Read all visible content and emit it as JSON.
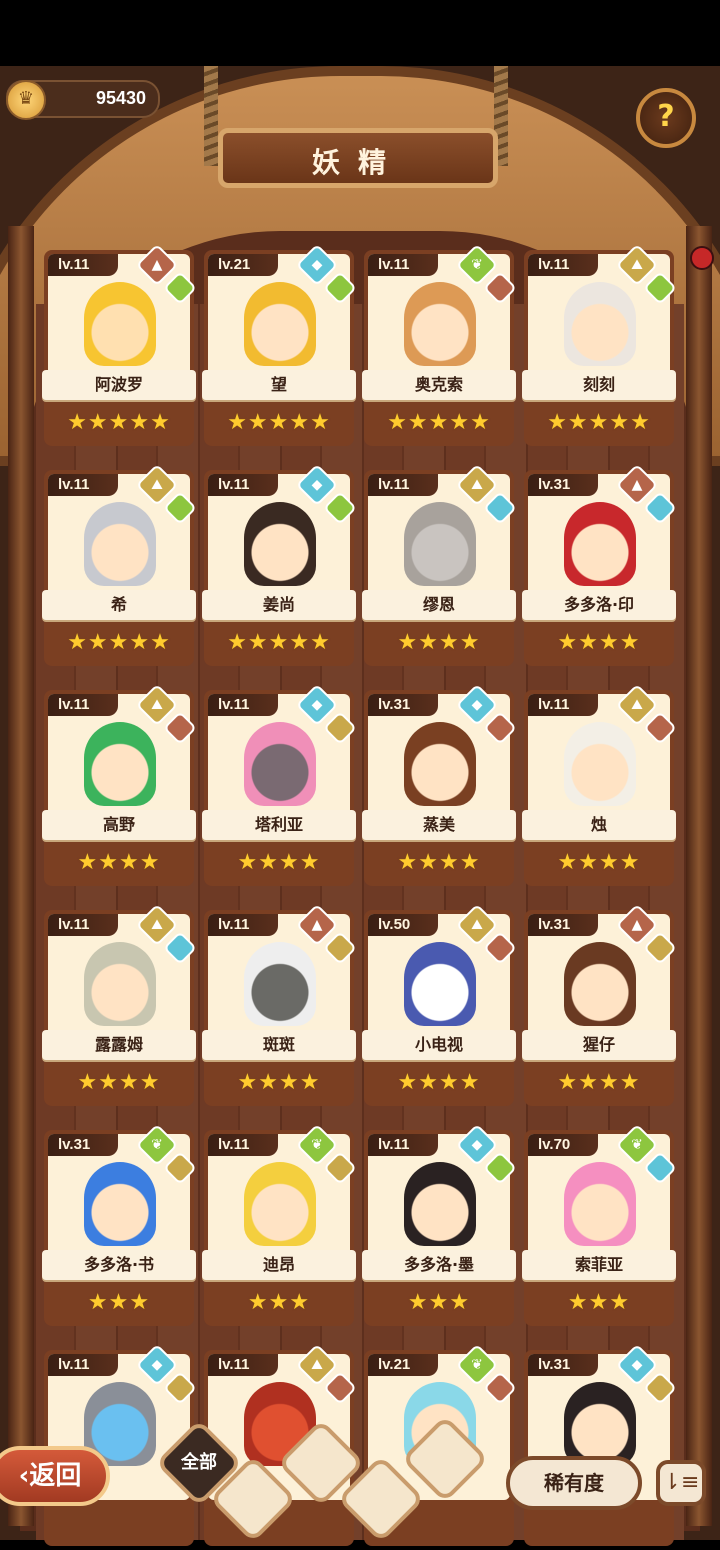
{
  "header": {
    "coins": "95430",
    "title": "妖精",
    "help_icon": "question-icon"
  },
  "colors": {
    "nature": "#8dc63f",
    "water": "#5ec4d8",
    "earth": "#c9a84a",
    "fire": "#b5654a"
  },
  "cards": [
    {
      "lv": "lv.11",
      "name": "阿波罗",
      "stars": "★★★★★",
      "el1": "fire",
      "el2": "nature",
      "skin": "#ffe0b0",
      "hair": "#f7c531"
    },
    {
      "lv": "lv.21",
      "name": "望",
      "stars": "★★★★★",
      "el1": "water",
      "el2": "nature",
      "skin": "#ffe3c4",
      "hair": "#f2bb30"
    },
    {
      "lv": "lv.11",
      "name": "奥克索",
      "stars": "★★★★★",
      "el1": "nature",
      "el2": "fire",
      "skin": "#ffe3c4",
      "hair": "#dd9a55"
    },
    {
      "lv": "lv.11",
      "name": "刻刻",
      "stars": "★★★★★",
      "el1": "earth",
      "el2": "nature",
      "skin": "#ffe3c4",
      "hair": "#ece6df"
    },
    {
      "lv": "lv.11",
      "name": "希",
      "stars": "★★★★★",
      "el1": "earth",
      "el2": "nature",
      "skin": "#ffe3c4",
      "hair": "#c7c9cf"
    },
    {
      "lv": "lv.11",
      "name": "姜尚",
      "stars": "★★★★★",
      "el1": "water",
      "el2": "nature",
      "skin": "#ffe3c4",
      "hair": "#3a2a22"
    },
    {
      "lv": "lv.11",
      "name": "缪恩",
      "stars": "★★★★",
      "el1": "earth",
      "el2": "water",
      "skin": "#c9c4c0",
      "hair": "#a8a29c"
    },
    {
      "lv": "lv.31",
      "name": "多多洛·印",
      "stars": "★★★★",
      "el1": "fire",
      "el2": "water",
      "skin": "#ffe3c4",
      "hair": "#c8282c"
    },
    {
      "lv": "lv.11",
      "name": "高野",
      "stars": "★★★★",
      "el1": "earth",
      "el2": "fire",
      "skin": "#ffe3c4",
      "hair": "#3cb35c"
    },
    {
      "lv": "lv.11",
      "name": "塔利亚",
      "stars": "★★★★",
      "el1": "water",
      "el2": "earth",
      "skin": "#7a6a72",
      "hair": "#f08fb8"
    },
    {
      "lv": "lv.31",
      "name": "蒸美",
      "stars": "★★★★",
      "el1": "water",
      "el2": "fire",
      "skin": "#ffe3c4",
      "hair": "#7a4022"
    },
    {
      "lv": "lv.11",
      "name": "烛",
      "stars": "★★★★",
      "el1": "earth",
      "el2": "fire",
      "skin": "#ffe3c4",
      "hair": "#f3efe6"
    },
    {
      "lv": "lv.11",
      "name": "露露姆",
      "stars": "★★★★",
      "el1": "earth",
      "el2": "water",
      "skin": "#ffe3c4",
      "hair": "#c8c6b0"
    },
    {
      "lv": "lv.11",
      "name": "斑斑",
      "stars": "★★★★",
      "el1": "fire",
      "el2": "earth",
      "skin": "#6a6a66",
      "hair": "#eeeeee"
    },
    {
      "lv": "lv.50",
      "name": "小电视",
      "stars": "★★★★",
      "el1": "earth",
      "el2": "fire",
      "skin": "#ffffff",
      "hair": "#4a5ab0"
    },
    {
      "lv": "lv.31",
      "name": "猩仔",
      "stars": "★★★★",
      "el1": "fire",
      "el2": "earth",
      "skin": "#ffe3c4",
      "hair": "#6a3a22"
    },
    {
      "lv": "lv.31",
      "name": "多多洛·书",
      "stars": "★★★",
      "el1": "nature",
      "el2": "earth",
      "skin": "#ffe3c4",
      "hair": "#3c7ee0"
    },
    {
      "lv": "lv.11",
      "name": "迪昂",
      "stars": "★★★",
      "el1": "nature",
      "el2": "earth",
      "skin": "#ffe3c4",
      "hair": "#f4cf3e"
    },
    {
      "lv": "lv.11",
      "name": "多多洛·墨",
      "stars": "★★★",
      "el1": "water",
      "el2": "nature",
      "skin": "#ffe3c4",
      "hair": "#2a2222"
    },
    {
      "lv": "lv.70",
      "name": "索菲亚",
      "stars": "★★★",
      "el1": "nature",
      "el2": "water",
      "skin": "#ffe3c4",
      "hair": "#f58fc0"
    },
    {
      "lv": "lv.11",
      "name": "",
      "stars": "",
      "el1": "water",
      "el2": "earth",
      "skin": "#6ac0f0",
      "hair": "#8a8f98"
    },
    {
      "lv": "lv.11",
      "name": "",
      "stars": "",
      "el1": "earth",
      "el2": "fire",
      "skin": "#e05030",
      "hair": "#b03020"
    },
    {
      "lv": "lv.21",
      "name": "",
      "stars": "",
      "el1": "nature",
      "el2": "fire",
      "skin": "#ffe3c4",
      "hair": "#8ad8e8"
    },
    {
      "lv": "lv.31",
      "name": "",
      "stars": "",
      "el1": "water",
      "el2": "earth",
      "skin": "#ffe3c4",
      "hair": "#2a2222"
    }
  ],
  "footer": {
    "back_label": "返回",
    "filter_all": "全部",
    "rarity_label": "稀有度",
    "sort_icon": "sort-icon"
  }
}
